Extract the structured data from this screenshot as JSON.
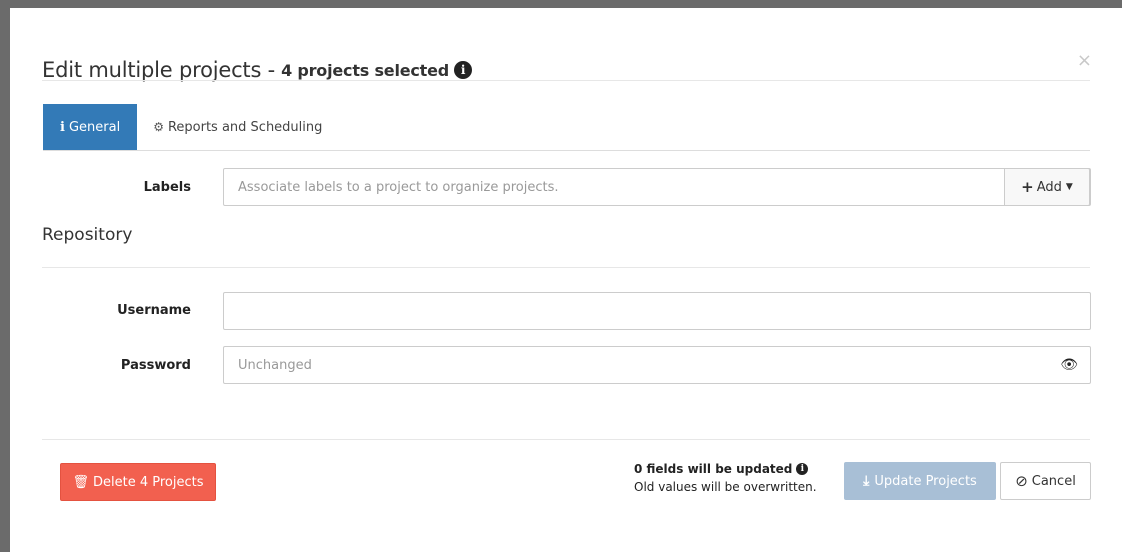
{
  "modal": {
    "title": "Edit multiple projects -",
    "selection": "4 projects selected",
    "close_glyph": "×"
  },
  "tabs": [
    {
      "label": "General",
      "icon": "info-icon"
    },
    {
      "label": "Reports and Scheduling",
      "icon": "gears-icon"
    }
  ],
  "labels_field": {
    "label": "Labels",
    "placeholder": "Associate labels to a project to organize projects.",
    "add_label": "Add"
  },
  "repository": {
    "title": "Repository",
    "username_label": "Username",
    "username_value": "",
    "password_label": "Password",
    "password_placeholder": "Unchanged"
  },
  "footer": {
    "delete_label": "Delete 4 Projects",
    "fields_info": "0 fields will be updated",
    "overwrite_info": "Old values will be overwritten.",
    "update_label": "Update Projects",
    "cancel_label": "Cancel"
  },
  "colors": {
    "primary": "#337ab7",
    "danger": "#f2604f",
    "disabled_primary": "#a8bfd6"
  }
}
